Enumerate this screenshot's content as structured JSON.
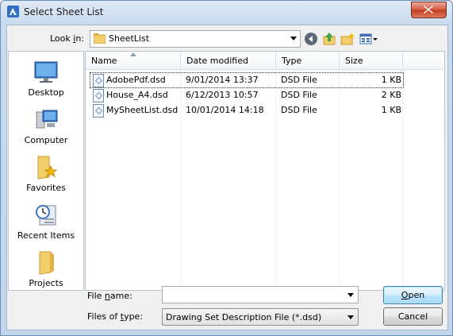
{
  "window": {
    "title": "Select Sheet List"
  },
  "lookin": {
    "label_pre": "Look ",
    "label_u": "i",
    "label_post": "n:",
    "value": "SheetList"
  },
  "toolbar": {
    "icons": [
      "back-icon",
      "up-folder-icon",
      "new-folder-icon",
      "views-menu-icon"
    ]
  },
  "places": [
    {
      "label": "Desktop",
      "icon": "desktop-icon"
    },
    {
      "label": "Computer",
      "icon": "computer-icon"
    },
    {
      "label": "Favorites",
      "icon": "favorites-icon"
    },
    {
      "label": "Recent Items",
      "icon": "recent-items-icon"
    },
    {
      "label": "Projects",
      "icon": "projects-folder-icon"
    }
  ],
  "columns": [
    "Name",
    "Date modified",
    "Type",
    "Size"
  ],
  "files": [
    {
      "name": "AdobePdf.dsd",
      "date": "9/01/2014 13:37",
      "type": "DSD File",
      "size": "1 KB"
    },
    {
      "name": "House_A4.dsd",
      "date": "6/12/2013 10:57",
      "type": "DSD File",
      "size": "2 KB"
    },
    {
      "name": "MySheetList.dsd",
      "date": "10/01/2014 14:18",
      "type": "DSD File",
      "size": "1 KB"
    }
  ],
  "filename": {
    "label_pre": "File ",
    "label_u": "n",
    "label_post": "ame:",
    "value": ""
  },
  "filetype": {
    "label_pre": "Files of ",
    "label_u": "t",
    "label_post": "ype:",
    "value": "Drawing Set Description File (*.dsd)"
  },
  "buttons": {
    "open_u": "O",
    "open_rest": "pen",
    "cancel": "Cancel"
  }
}
